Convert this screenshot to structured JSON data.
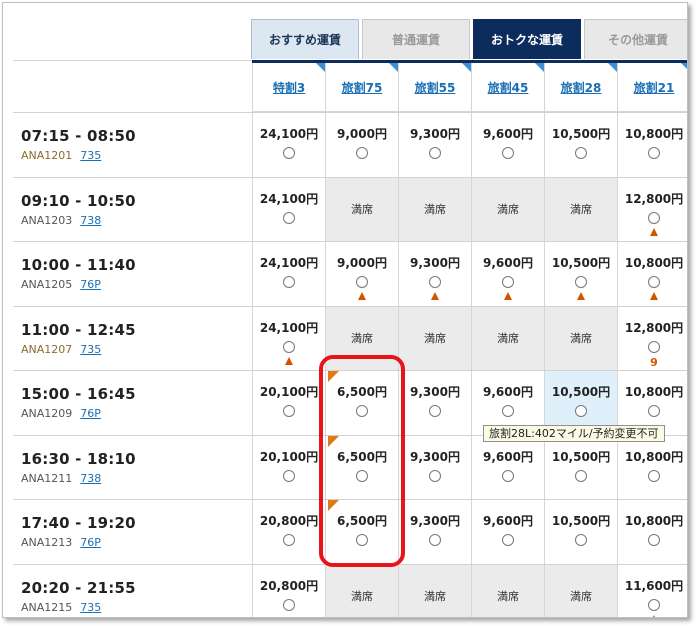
{
  "tabs": [
    {
      "label": "おすすめ運賃",
      "state": "light"
    },
    {
      "label": "普通運賃",
      "state": "inactive"
    },
    {
      "label": "おトクな運賃",
      "state": "active"
    },
    {
      "label": "その他運賃",
      "state": "inactive"
    }
  ],
  "columns": [
    "特割3",
    "旅割75",
    "旅割55",
    "旅割45",
    "旅割28",
    "旅割21"
  ],
  "rows": [
    {
      "time": "07:15 - 08:50",
      "flight": "ANA1201",
      "equipment": "735",
      "code_style": "brown",
      "cells": [
        {
          "price": "24,100円"
        },
        {
          "price": "9,000円"
        },
        {
          "price": "9,300円"
        },
        {
          "price": "9,600円"
        },
        {
          "price": "10,500円"
        },
        {
          "price": "10,800円"
        }
      ]
    },
    {
      "time": "09:10 - 10:50",
      "flight": "ANA1203",
      "equipment": "738",
      "code_style": "gray",
      "cells": [
        {
          "price": "24,100円"
        },
        {
          "full": "満席"
        },
        {
          "full": "満席"
        },
        {
          "full": "満席"
        },
        {
          "full": "満席"
        },
        {
          "price": "12,800円",
          "warn": true
        }
      ]
    },
    {
      "time": "10:00 - 11:40",
      "flight": "ANA1205",
      "equipment": "76P",
      "code_style": "gray",
      "cells": [
        {
          "price": "24,100円"
        },
        {
          "price": "9,000円",
          "warn": true
        },
        {
          "price": "9,300円",
          "warn": true
        },
        {
          "price": "9,600円",
          "warn": true
        },
        {
          "price": "10,500円",
          "warn": true
        },
        {
          "price": "10,800円",
          "warn": true
        }
      ]
    },
    {
      "time": "11:00 - 12:45",
      "flight": "ANA1207",
      "equipment": "735",
      "code_style": "brown",
      "cells": [
        {
          "price": "24,100円",
          "warn": true
        },
        {
          "full": "満席"
        },
        {
          "full": "満席"
        },
        {
          "full": "満席"
        },
        {
          "full": "満席"
        },
        {
          "price": "12,800円",
          "seats": "9"
        }
      ]
    },
    {
      "time": "15:00 - 16:45",
      "flight": "ANA1209",
      "equipment": "76P",
      "code_style": "gray",
      "cells": [
        {
          "price": "20,100円"
        },
        {
          "price": "6,500円",
          "flag": true
        },
        {
          "price": "9,300円"
        },
        {
          "price": "9,600円"
        },
        {
          "price": "10,500円",
          "hl": true
        },
        {
          "price": "10,800円"
        }
      ]
    },
    {
      "time": "16:30 - 18:10",
      "flight": "ANA1211",
      "equipment": "738",
      "code_style": "gray",
      "cells": [
        {
          "price": "20,100円"
        },
        {
          "price": "6,500円",
          "flag": true
        },
        {
          "price": "9,300円"
        },
        {
          "price": "9,600円"
        },
        {
          "price": "10,500円"
        },
        {
          "price": "10,800円"
        }
      ]
    },
    {
      "time": "17:40 - 19:20",
      "flight": "ANA1213",
      "equipment": "76P",
      "code_style": "gray",
      "cells": [
        {
          "price": "20,800円"
        },
        {
          "price": "6,500円",
          "flag": true
        },
        {
          "price": "9,300円"
        },
        {
          "price": "9,600円"
        },
        {
          "price": "10,500円"
        },
        {
          "price": "10,800円"
        }
      ]
    },
    {
      "time": "20:20 - 21:55",
      "flight": "ANA1215",
      "equipment": "735",
      "code_style": "gray",
      "cells": [
        {
          "price": "20,800円"
        },
        {
          "full": "満席"
        },
        {
          "full": "満席"
        },
        {
          "full": "満席"
        },
        {
          "full": "満席"
        },
        {
          "price": "11,600円",
          "warn": true
        }
      ]
    }
  ],
  "tooltip": "旅割28L:402マイル/予約変更不可",
  "colors": {
    "active_tab": "#0b2c5c",
    "link": "#1a6fb4",
    "warn": "#d35400",
    "highlight_box": "#e8141a",
    "flag": "#e07a17"
  }
}
